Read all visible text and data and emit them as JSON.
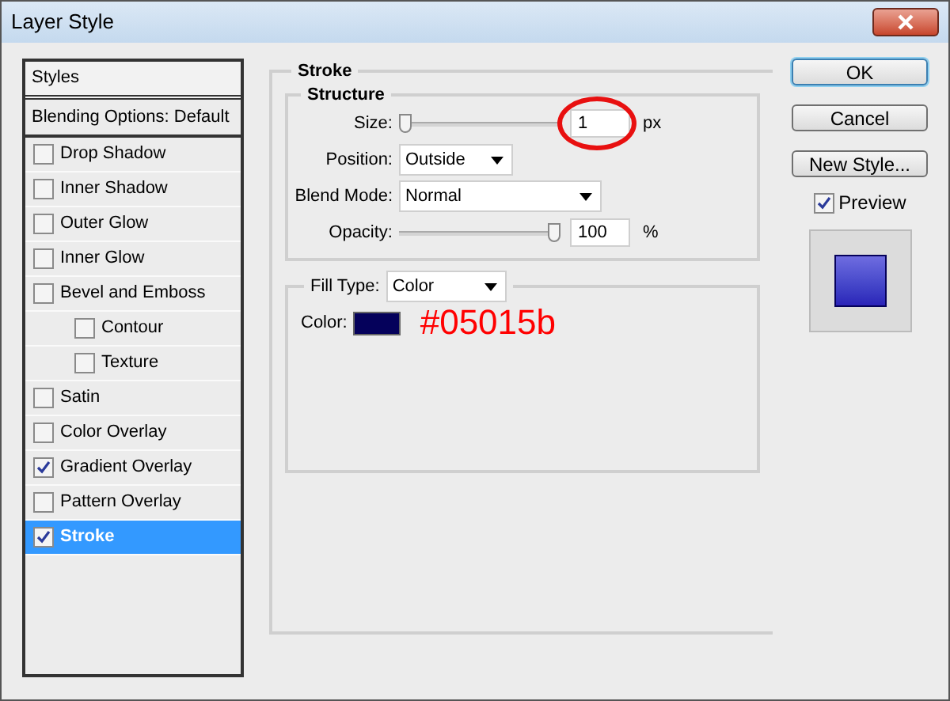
{
  "window": {
    "title": "Layer Style"
  },
  "styles_panel": {
    "header": "Styles",
    "items": [
      {
        "kind": "plain",
        "label": "Blending Options: Default",
        "selected": false
      },
      {
        "kind": "option",
        "label": "Drop Shadow",
        "checked": false,
        "selected": false
      },
      {
        "kind": "option",
        "label": "Inner Shadow",
        "checked": false,
        "selected": false
      },
      {
        "kind": "option",
        "label": "Outer Glow",
        "checked": false,
        "selected": false
      },
      {
        "kind": "option",
        "label": "Inner Glow",
        "checked": false,
        "selected": false
      },
      {
        "kind": "option",
        "label": "Bevel and Emboss",
        "checked": false,
        "selected": false,
        "children": [
          {
            "kind": "option",
            "label": "Contour",
            "checked": false,
            "selected": false
          },
          {
            "kind": "option",
            "label": "Texture",
            "checked": false,
            "selected": false
          }
        ]
      },
      {
        "kind": "option",
        "label": "Satin",
        "checked": false,
        "selected": false
      },
      {
        "kind": "option",
        "label": "Color Overlay",
        "checked": false,
        "selected": false
      },
      {
        "kind": "option",
        "label": "Gradient Overlay",
        "checked": true,
        "selected": false
      },
      {
        "kind": "option",
        "label": "Pattern Overlay",
        "checked": false,
        "selected": false
      },
      {
        "kind": "option",
        "label": "Stroke",
        "checked": true,
        "selected": true
      }
    ]
  },
  "stroke": {
    "title": "Stroke",
    "structure": {
      "title": "Structure",
      "size": {
        "label": "Size:",
        "level": 0,
        "value": "1",
        "unit": "px"
      },
      "position": {
        "label": "Position:",
        "value": "Outside"
      },
      "blend_mode": {
        "label": "Blend Mode:",
        "value": "Normal"
      },
      "opacity": {
        "label": "Opacity:",
        "level": 1,
        "value": "100",
        "unit": "%"
      }
    },
    "fill_type": {
      "label": "Fill Type:",
      "value": "Color"
    },
    "color": {
      "label": "Color:",
      "color": "#05015b"
    }
  },
  "annotation": {
    "text": "#05015b"
  },
  "buttons": [
    "OK",
    "Cancel",
    "New Style..."
  ],
  "preview": {
    "label": "Preview",
    "checked": true
  }
}
